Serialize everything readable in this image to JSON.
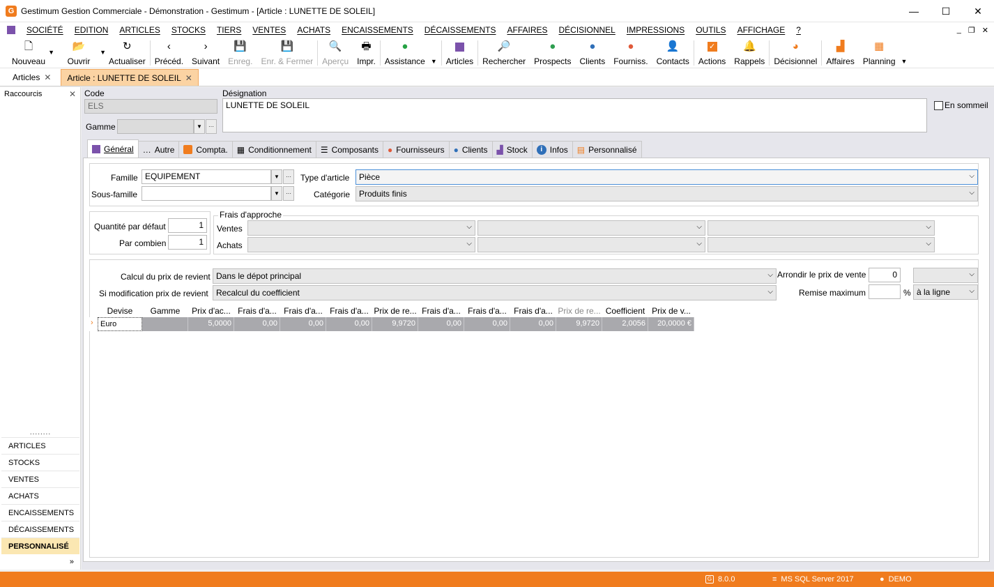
{
  "window": {
    "title": "Gestimum Gestion Commerciale - Démonstration - Gestimum - [Article : LUNETTE DE SOLEIL]",
    "logo_letter": "G"
  },
  "menu": [
    "SOCIÉTÉ",
    "EDITION",
    "ARTICLES",
    "STOCKS",
    "TIERS",
    "VENTES",
    "ACHATS",
    "ENCAISSEMENTS",
    "DÉCAISSEMENTS",
    "AFFAIRES",
    "DÉCISIONNEL",
    "IMPRESSIONS",
    "OUTILS",
    "AFFICHAGE",
    "?"
  ],
  "toolbar": {
    "nouveau": "Nouveau",
    "ouvrir": "Ouvrir",
    "actualiser": "Actualiser",
    "preced": "Précéd.",
    "suivant": "Suivant",
    "enreg": "Enreg.",
    "enr_fermer": "Enr. & Fermer",
    "apercu": "Aperçu",
    "impr": "Impr.",
    "assistance": "Assistance",
    "articles": "Articles",
    "rechercher": "Rechercher",
    "prospects": "Prospects",
    "clients": "Clients",
    "fourniss": "Fourniss.",
    "contacts": "Contacts",
    "actions": "Actions",
    "rappels": "Rappels",
    "decisionnel": "Décisionnel",
    "affaires": "Affaires",
    "planning": "Planning"
  },
  "doc_tabs": {
    "articles": "Articles",
    "article": "Article : LUNETTE DE SOLEIL"
  },
  "left_panel": {
    "title": "Raccourcis",
    "dots": "........",
    "items": [
      "ARTICLES",
      "STOCKS",
      "VENTES",
      "ACHATS",
      "ENCAISSEMENTS",
      "DÉCAISSEMENTS",
      "PERSONNALISÉ"
    ],
    "chevron": "»"
  },
  "header": {
    "code_label": "Code",
    "code_value": "ELS",
    "gamme_label": "Gamme",
    "designation_label": "Désignation",
    "designation_value": "LUNETTE DE SOLEIL",
    "sommeil_label": "En sommeil"
  },
  "tabs": [
    "Général",
    "Autre",
    "Compta.",
    "Conditionnement",
    "Composants",
    "Fournisseurs",
    "Clients",
    "Stock",
    "Infos",
    "Personnalisé"
  ],
  "general": {
    "famille_label": "Famille",
    "famille_value": "EQUIPEMENT",
    "sous_famille_label": "Sous-famille",
    "sous_famille_value": "",
    "type_label": "Type d'article",
    "type_value": "Pièce",
    "categorie_label": "Catégorie",
    "categorie_value": "Produits finis",
    "qte_label": "Quantité par défaut",
    "qte_value": "1",
    "par_combien_label": "Par combien",
    "par_combien_value": "1",
    "frais_title": "Frais d'approche",
    "ventes_label": "Ventes",
    "achats_label": "Achats",
    "calcul_label": "Calcul du prix de revient",
    "calcul_value": "Dans le dépot principal",
    "modif_label": "Si modification prix de revient",
    "modif_value": "Recalcul du coefficient",
    "arrondir_label": "Arrondir le prix de vente",
    "arrondir_value": "0",
    "remise_label": "Remise maximum",
    "remise_unit": "%",
    "remise_mode": "à la ligne"
  },
  "grid": {
    "headers": [
      "Devise",
      "Gamme",
      "Prix d'ac...",
      "Frais d'a...",
      "Frais d'a...",
      "Frais d'a...",
      "Prix de re...",
      "Frais d'a...",
      "Frais d'a...",
      "Frais d'a...",
      "Prix de re...",
      "Coefficient",
      "Prix de v..."
    ],
    "row": [
      "Euro",
      "",
      "5,0000",
      "0,00",
      "0,00",
      "0,00",
      "9,9720",
      "0,00",
      "0,00",
      "0,00",
      "9,9720",
      "2,0056",
      "20,0000 €"
    ]
  },
  "status": {
    "version": "8.0.0",
    "server": "MS SQL Server 2017",
    "user": "DEMO"
  },
  "colors": {
    "accent": "#f07c1e",
    "purple": "#7b52ab",
    "tab_active": "#fbd3a3",
    "left_active": "#fbe7b2"
  }
}
